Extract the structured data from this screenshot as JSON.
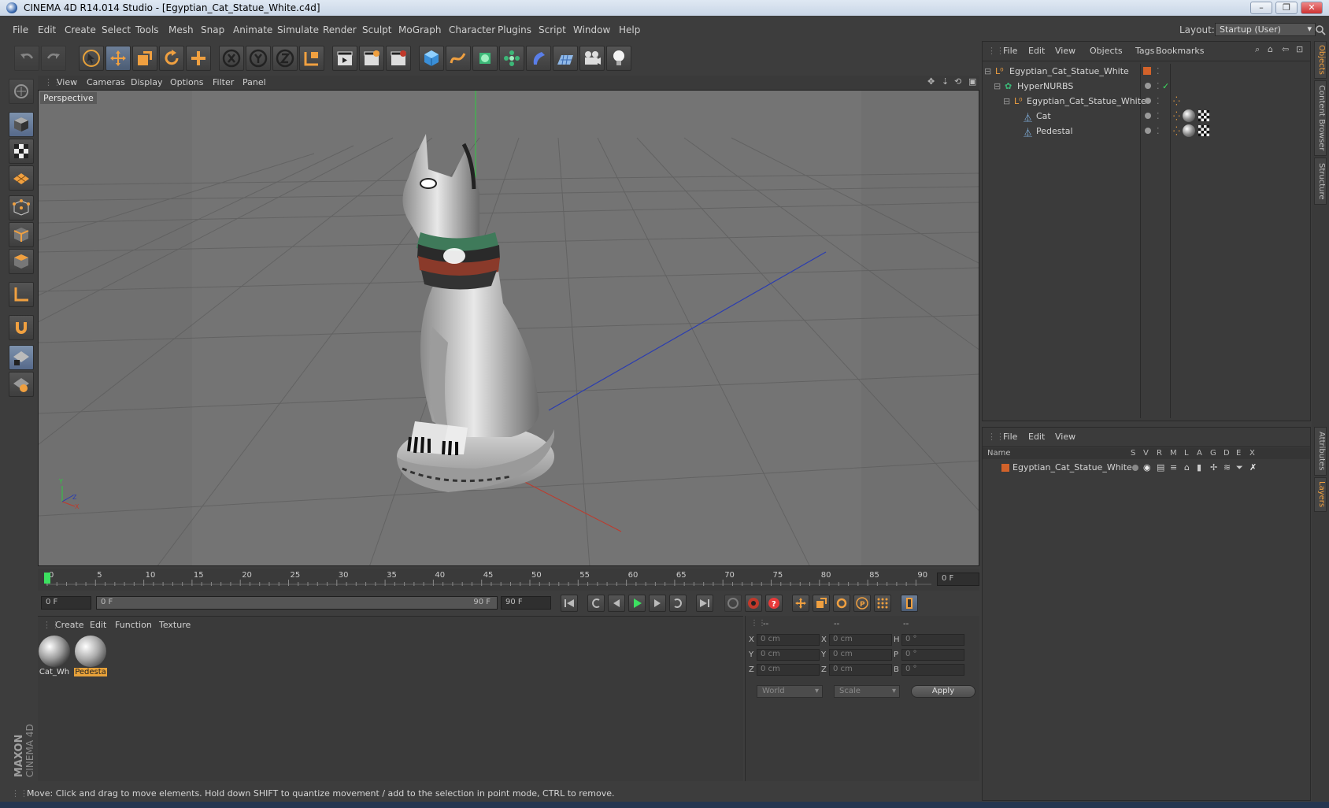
{
  "window": {
    "title": "CINEMA 4D R14.014 Studio - [Egyptian_Cat_Statue_White.c4d]"
  },
  "menu": [
    "File",
    "Edit",
    "Create",
    "Select",
    "Tools",
    "Mesh",
    "Snap",
    "Animate",
    "Simulate",
    "Render",
    "Sculpt",
    "MoGraph",
    "Character",
    "Plugins",
    "Script",
    "Window",
    "Help"
  ],
  "layout": {
    "label": "Layout:",
    "value": "Startup (User)"
  },
  "viewport": {
    "menu": [
      "View",
      "Cameras",
      "Display",
      "Options",
      "Filter",
      "Panel"
    ],
    "label": "Perspective"
  },
  "timeline": {
    "ticks": [
      "0",
      "5",
      "10",
      "15",
      "20",
      "25",
      "30",
      "35",
      "40",
      "45",
      "50",
      "55",
      "60",
      "65",
      "70",
      "75",
      "80",
      "85",
      "90"
    ],
    "current_frame": "0 F",
    "start_field": "0 F",
    "range_start": "0 F",
    "range_end": "90 F",
    "end_field": "90 F"
  },
  "materials": {
    "menu": [
      "Create",
      "Edit",
      "Function",
      "Texture"
    ],
    "items": [
      {
        "label": "Cat_Wh",
        "selected": false
      },
      {
        "label": "Pedesta",
        "selected": true
      }
    ]
  },
  "coordinates": {
    "headers": [
      "--",
      "--",
      "--"
    ],
    "rows": [
      {
        "a": "X",
        "av": "0 cm",
        "b": "X",
        "bv": "0 cm",
        "c": "H",
        "cv": "0 °"
      },
      {
        "a": "Y",
        "av": "0 cm",
        "b": "Y",
        "bv": "0 cm",
        "c": "P",
        "cv": "0 °"
      },
      {
        "a": "Z",
        "av": "0 cm",
        "b": "Z",
        "bv": "0 cm",
        "c": "B",
        "cv": "0 °"
      }
    ],
    "space": "World",
    "mode": "Scale",
    "apply": "Apply"
  },
  "status": "Move: Click and drag to move elements. Hold down SHIFT to quantize movement / add to the selection in point mode, CTRL to remove.",
  "objects_panel": {
    "menu": [
      "File",
      "Edit",
      "View",
      "Objects",
      "Tags",
      "Bookmarks"
    ],
    "items": [
      {
        "name": "Egyptian_Cat_Statue_White",
        "type": "null"
      },
      {
        "name": "HyperNURBS",
        "type": "hypernurbs"
      },
      {
        "name": "Egyptian_Cat_Statue_White",
        "type": "null"
      },
      {
        "name": "Cat",
        "type": "polygon"
      },
      {
        "name": "Pedestal",
        "type": "polygon"
      }
    ]
  },
  "layers_panel": {
    "menu": [
      "File",
      "Edit",
      "View"
    ],
    "columns": [
      "Name",
      "S",
      "V",
      "R",
      "M",
      "L",
      "A",
      "G",
      "D",
      "E",
      "X"
    ],
    "items": [
      {
        "name": "Egyptian_Cat_Statue_White",
        "color": "#d2622a"
      }
    ]
  },
  "right_tabs": [
    "Objects",
    "Content Browser",
    "Structure",
    "Attributes",
    "Layers"
  ],
  "colors": {
    "accent": "#f0a040",
    "selection": "#e8a23a",
    "axis_x": "#c0392b",
    "axis_y": "#2ecc40",
    "axis_z": "#2b3db0"
  }
}
